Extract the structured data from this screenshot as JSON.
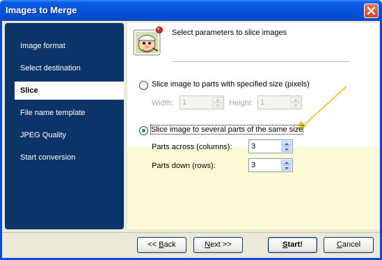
{
  "window": {
    "title": "Images to Merge"
  },
  "sidebar": {
    "items": [
      {
        "label": "Image format",
        "active": false
      },
      {
        "label": "Select destination",
        "active": false
      },
      {
        "label": "Slice",
        "active": true
      },
      {
        "label": "File name template",
        "active": false
      },
      {
        "label": "JPEG Quality",
        "active": false
      },
      {
        "label": "Start conversion",
        "active": false
      }
    ]
  },
  "header": {
    "text": "Select parameters to slice images",
    "icon": "popeye-cartoon-icon"
  },
  "options": {
    "by_size": {
      "label": "Slice image to parts with specified size (pixels)",
      "selected": false,
      "width_label": "Width:",
      "width_value": "1",
      "height_label": "Height:",
      "height_value": "1"
    },
    "by_parts": {
      "label": "Slice image to several parts of the same size",
      "selected": true,
      "across_label": "Parts across (columns):",
      "across_value": "3",
      "down_label": "Parts down (rows):",
      "down_value": "3"
    }
  },
  "buttons": {
    "back_prefix": "<< ",
    "back_accel": "B",
    "back_rest": "ack",
    "next_accel": "N",
    "next_rest": "ext >>",
    "start_accel": "S",
    "start_rest": "tart!",
    "cancel_accel": "C",
    "cancel_rest": "ancel"
  },
  "colors": {
    "sidebar_bg": "#0c3468",
    "highlight_bg": "#fefad8",
    "arrow": "#f2c744",
    "radio_dot": "#21a121"
  }
}
